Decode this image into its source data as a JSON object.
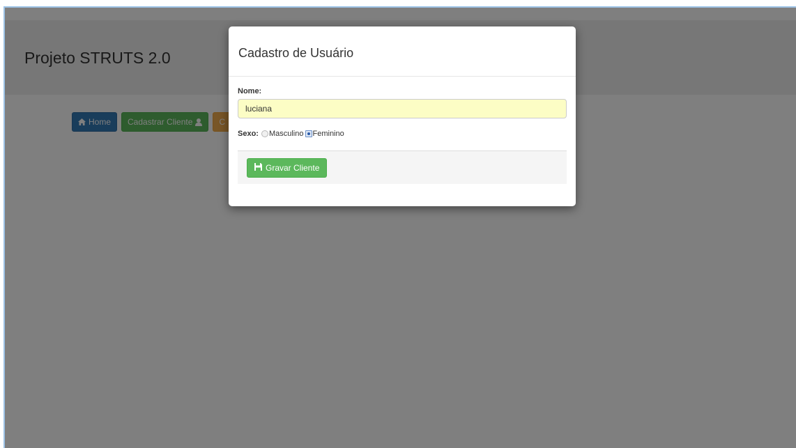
{
  "app": {
    "title": "Projeto STRUTS 2.0"
  },
  "nav": {
    "home_label": "Home",
    "home_icon": "home-icon",
    "cadastrar_label": "Cadastrar Cliente",
    "cadastrar_icon": "user-icon",
    "third_label": "C"
  },
  "modal": {
    "title": "Cadastro de Usuário",
    "nome_label": "Nome:",
    "nome_value": "luciana",
    "sexo_label": "Sexo:",
    "options": [
      "Masculino",
      "Feminino"
    ],
    "selected_option": "Feminino",
    "save_label": "Gravar Cliente",
    "save_icon": "floppy-disk-icon"
  },
  "colors": {
    "primary": "#337ab7",
    "success": "#5cb85c",
    "warning": "#f0ad4e",
    "input_highlight": "#fcfdc5"
  }
}
